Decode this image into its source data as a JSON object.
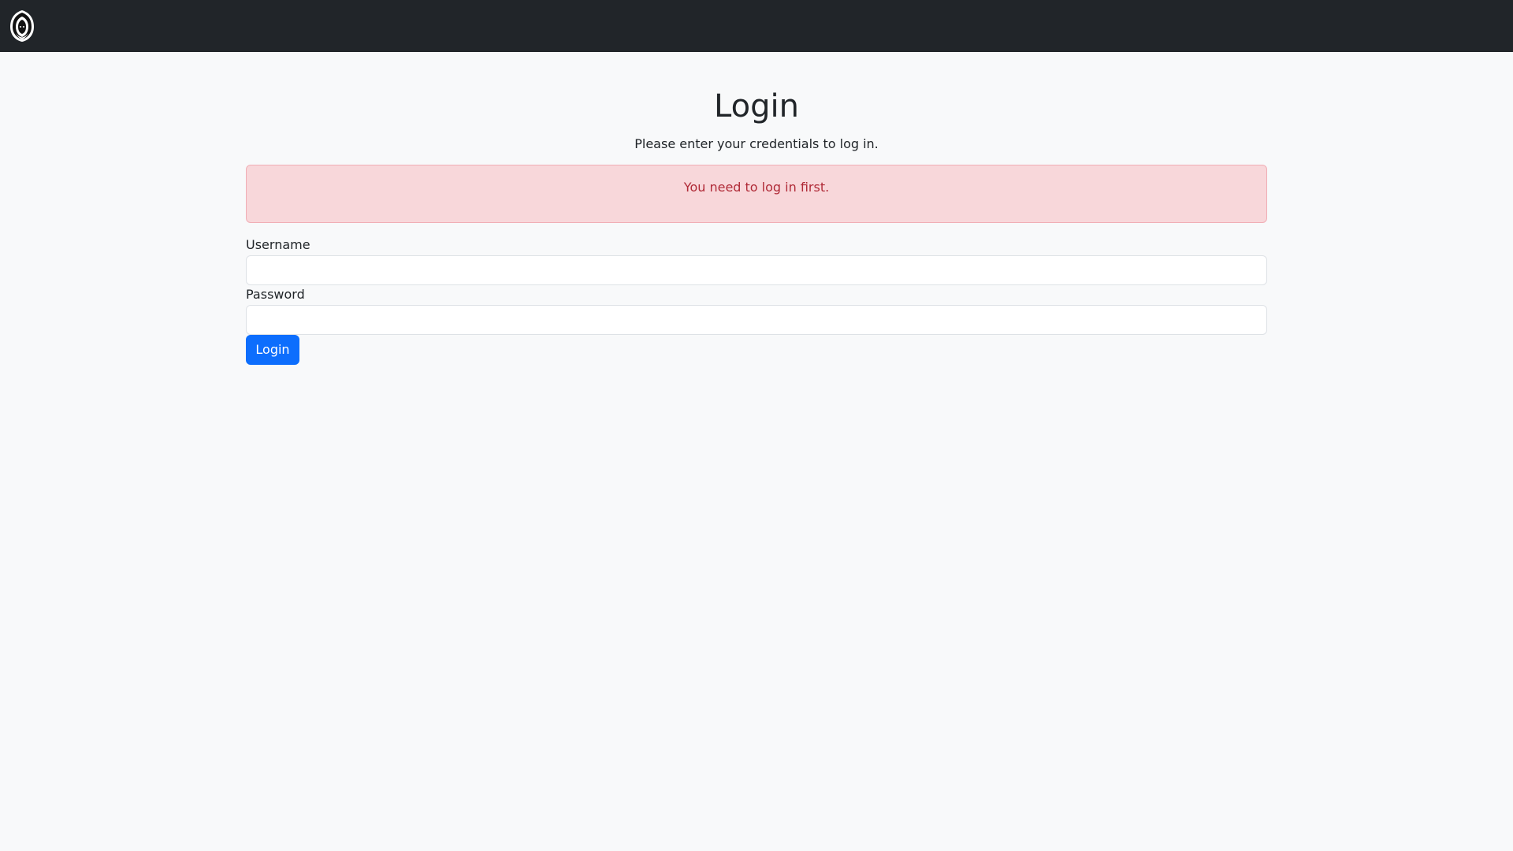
{
  "navbar": {
    "logo_icon": "hooded-figure-shield-logo-icon"
  },
  "page": {
    "title": "Login",
    "subtitle": "Please enter your credentials to log in."
  },
  "alert": {
    "message": "You need to log in first.",
    "type": "danger"
  },
  "form": {
    "username_label": "Username",
    "username_value": "",
    "username_placeholder": "",
    "password_label": "Password",
    "password_value": "",
    "password_placeholder": "",
    "submit_label": "Login"
  },
  "colors": {
    "navbar_bg": "#212529",
    "page_bg": "#f8f9fa",
    "alert_bg": "#f8d7da",
    "alert_text": "#b02a37",
    "primary": "#0d6efd"
  }
}
